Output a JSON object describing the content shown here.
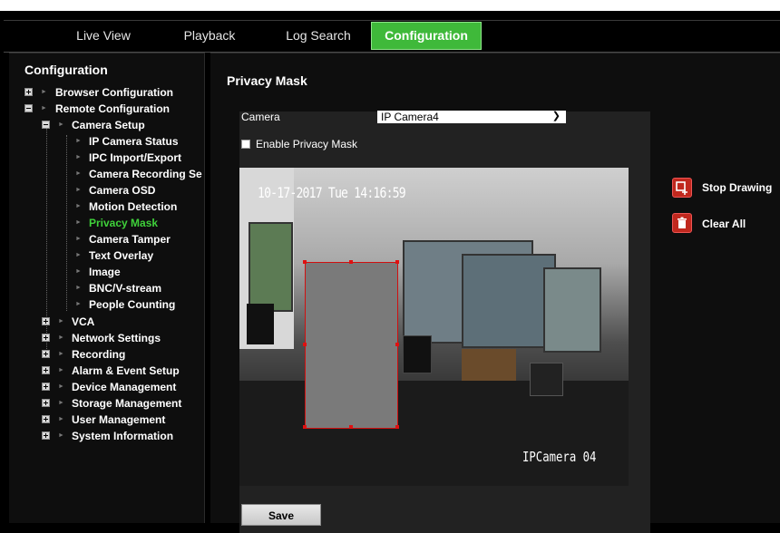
{
  "tabs": [
    {
      "label": "Live View",
      "active": false
    },
    {
      "label": "Playback",
      "active": false
    },
    {
      "label": "Log Search",
      "active": false
    },
    {
      "label": "Configuration",
      "active": true
    }
  ],
  "sidebar": {
    "title": "Configuration",
    "items": [
      {
        "label": "Browser Configuration",
        "expander": "plus"
      },
      {
        "label": "Remote Configuration",
        "expander": "minus"
      },
      {
        "label": "Camera Setup",
        "expander": "minus"
      },
      {
        "label": "IP Camera Status"
      },
      {
        "label": "IPC Import/Export"
      },
      {
        "label": "Camera Recording Se"
      },
      {
        "label": "Camera OSD"
      },
      {
        "label": "Motion Detection"
      },
      {
        "label": "Privacy Mask",
        "active": true
      },
      {
        "label": "Camera Tamper"
      },
      {
        "label": "Text Overlay"
      },
      {
        "label": "Image"
      },
      {
        "label": "BNC/V-stream"
      },
      {
        "label": "People Counting"
      },
      {
        "label": "VCA",
        "expander": "plus"
      },
      {
        "label": "Network Settings",
        "expander": "plus"
      },
      {
        "label": "Recording",
        "expander": "plus"
      },
      {
        "label": "Alarm & Event Setup",
        "expander": "plus"
      },
      {
        "label": "Device Management",
        "expander": "plus"
      },
      {
        "label": "Storage Management",
        "expander": "plus"
      },
      {
        "label": "User Management",
        "expander": "plus"
      },
      {
        "label": "System Information",
        "expander": "plus"
      }
    ]
  },
  "main": {
    "title": "Privacy Mask",
    "camera_label": "Camera",
    "camera_value": "IP Camera4",
    "enable_label": "Enable Privacy Mask",
    "enable_checked": false,
    "video": {
      "timestamp": "10-17-2017 Tue 14:16:59",
      "camera_name": "IPCamera 04"
    },
    "stop_drawing_label": "Stop Drawing",
    "clear_all_label": "Clear All",
    "save_label": "Save"
  },
  "colors": {
    "accent_green": "#3fb93a",
    "active_text_green": "#3fd13a",
    "mask_border": "#d01010",
    "button_red": "#c0281e"
  }
}
